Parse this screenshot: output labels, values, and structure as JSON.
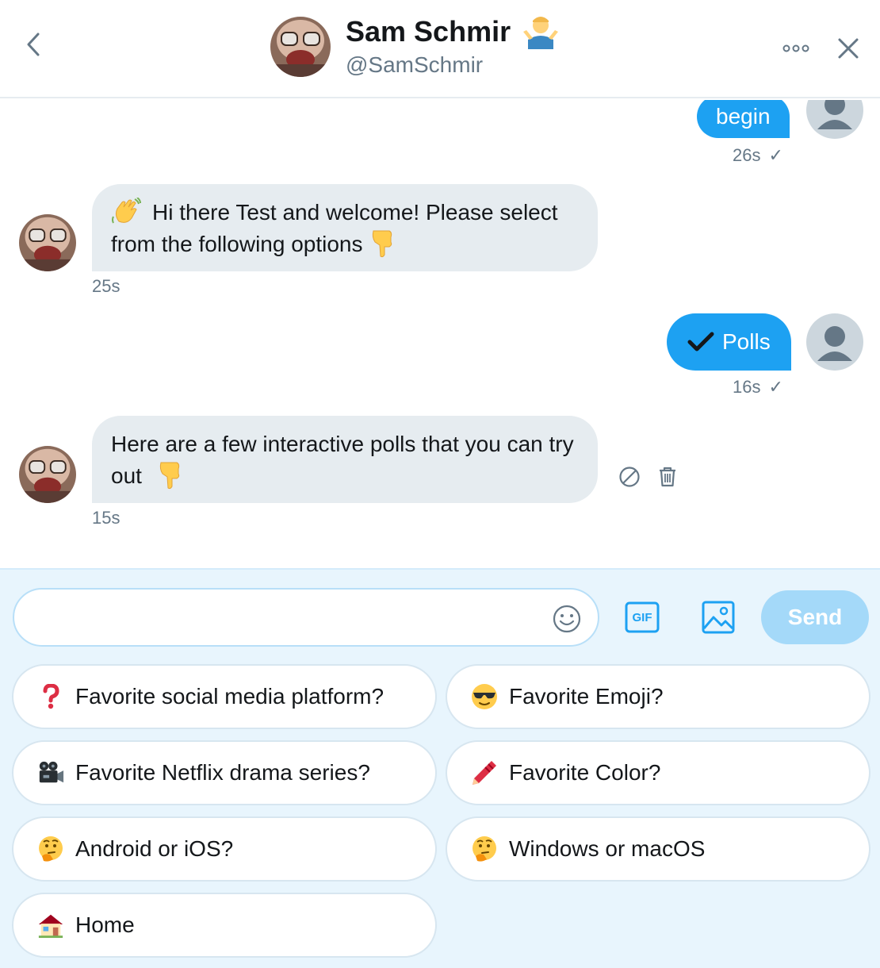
{
  "header": {
    "display_name": "Sam Schmir",
    "handle": "@SamSchmir"
  },
  "messages": [
    {
      "direction": "outgoing",
      "text": "begin",
      "time": "26s",
      "status": "✓"
    },
    {
      "direction": "incoming",
      "line1": "Hi there Test and welcome! Please select",
      "line2": "from the following options",
      "time": "25s"
    },
    {
      "direction": "outgoing",
      "text": "Polls",
      "time": "16s",
      "status": "✓"
    },
    {
      "direction": "incoming",
      "line1": "Here are a few interactive polls that you can try",
      "line2": "out",
      "time": "15s"
    }
  ],
  "composer": {
    "placeholder": "",
    "send_label": "Send",
    "gif_label": "GIF"
  },
  "quick_replies": [
    {
      "label": "Favorite social media platform?",
      "icon": "question-mark-icon"
    },
    {
      "label": "Favorite Emoji?",
      "icon": "sunglasses-face-icon"
    },
    {
      "label": "Favorite Netflix drama series?",
      "icon": "movie-camera-icon"
    },
    {
      "label": "Favorite Color?",
      "icon": "crayon-icon"
    },
    {
      "label": "Android or iOS?",
      "icon": "thinking-face-icon"
    },
    {
      "label": "Windows or macOS",
      "icon": "thinking-face-icon"
    },
    {
      "label": "Home",
      "icon": "house-icon"
    }
  ],
  "colors": {
    "accent": "#1da1f2",
    "send_disabled": "#a4d9f9",
    "bubble_incoming": "#e6ecf0",
    "composer_bg": "#e8f5fd",
    "muted_text": "#657786"
  }
}
